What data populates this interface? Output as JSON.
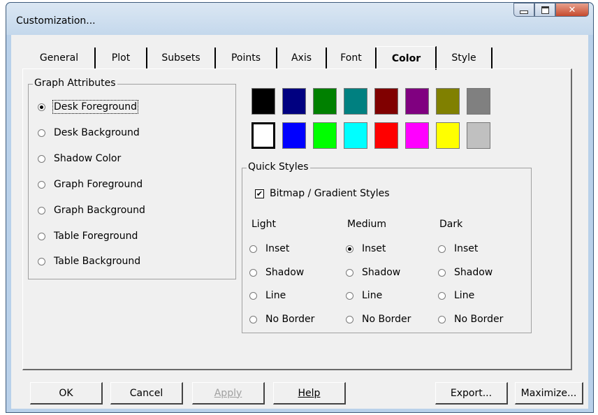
{
  "window": {
    "title": "Customization..."
  },
  "tabs": [
    "General",
    "Plot",
    "Subsets",
    "Points",
    "Axis",
    "Font",
    "Color",
    "Style"
  ],
  "active_tab": "Color",
  "graph_attributes": {
    "title": "Graph Attributes",
    "options": [
      "Desk Foreground",
      "Desk Background",
      "Shadow Color",
      "Graph Foreground",
      "Graph Background",
      "Table Foreground",
      "Table Background"
    ],
    "selected": "Desk Foreground"
  },
  "palette": {
    "row1": [
      "#000000",
      "#000080",
      "#008000",
      "#008080",
      "#800000",
      "#800080",
      "#808000",
      "#808080"
    ],
    "row2": [
      "#ffffff",
      "#0000ff",
      "#00ff00",
      "#00ffff",
      "#ff0000",
      "#ff00ff",
      "#ffff00",
      "#c0c0c0"
    ],
    "selected": "#ffffff"
  },
  "quick_styles": {
    "title": "Quick Styles",
    "bitmap_label": "Bitmap / Gradient Styles",
    "bitmap_checked": true,
    "columns": [
      "Light",
      "Medium",
      "Dark"
    ],
    "options": [
      "Inset",
      "Shadow",
      "Line",
      "No Border"
    ],
    "selected": {
      "column": "Medium",
      "option": "Inset"
    }
  },
  "buttons": {
    "ok": "OK",
    "cancel": "Cancel",
    "apply": "Apply",
    "help": "Help",
    "export": "Export...",
    "maximize": "Maximize..."
  }
}
